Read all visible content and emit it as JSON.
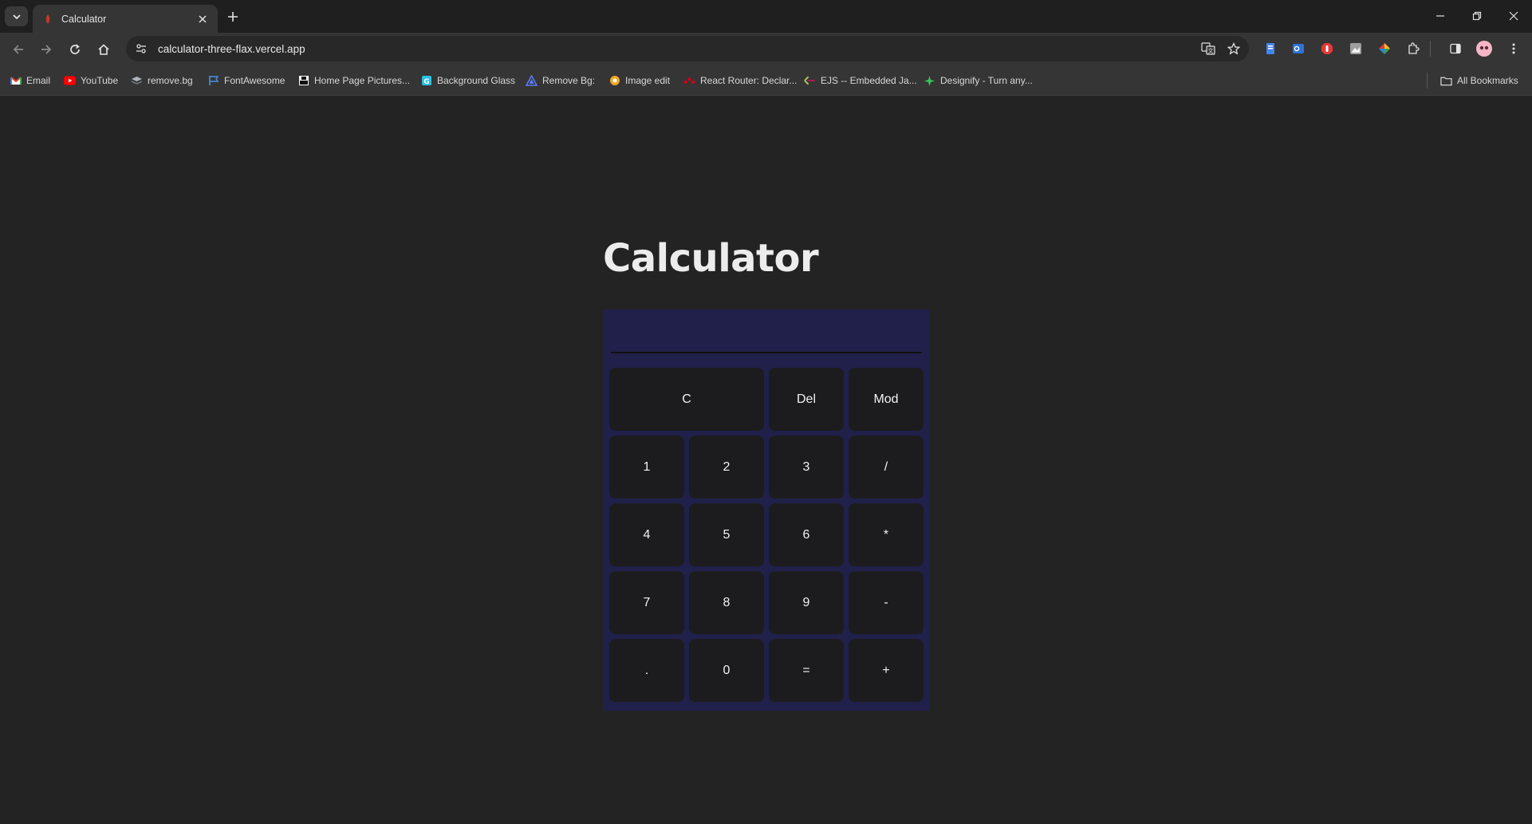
{
  "browser": {
    "tab_title": "Calculator",
    "url": "calculator-three-flax.vercel.app",
    "bookmarks": [
      {
        "label": "Email",
        "icon": "gmail-icon",
        "color": "#ea4335"
      },
      {
        "label": "YouTube",
        "icon": "youtube-icon",
        "color": "#ff0000"
      },
      {
        "label": "remove.bg",
        "icon": "removebg-icon",
        "color": "#9aa0a6"
      },
      {
        "label": "FontAwesome",
        "icon": "flag-icon",
        "color": "#4a90e2"
      },
      {
        "label": "Home Page Pictures...",
        "icon": "unsplash-icon",
        "color": "#ffffff"
      },
      {
        "label": "Background Glass",
        "icon": "glass-icon",
        "color": "#2bc0e4"
      },
      {
        "label": "Remove Bg:",
        "icon": "triangle-icon",
        "color": "#5b7cfa"
      },
      {
        "label": "Image edit",
        "icon": "image-edit-icon",
        "color": "#f5a623"
      },
      {
        "label": "React Router: Declar...",
        "icon": "react-router-icon",
        "color": "#d0021b"
      },
      {
        "label": "EJS -- Embedded Ja...",
        "icon": "ejs-icon",
        "color": "#b4ca65"
      },
      {
        "label": "Designify - Turn any...",
        "icon": "designify-icon",
        "color": "#34c759"
      }
    ],
    "all_bookmarks": "All Bookmarks"
  },
  "page": {
    "heading": "Calculator",
    "display_value": ""
  },
  "keys": {
    "clear": "C",
    "delete": "Del",
    "mod": "Mod",
    "one": "1",
    "two": "2",
    "three": "3",
    "divide": "/",
    "four": "4",
    "five": "5",
    "six": "6",
    "multiply": "*",
    "seven": "7",
    "eight": "8",
    "nine": "9",
    "minus": "-",
    "dot": ".",
    "zero": "0",
    "equals": "=",
    "plus": "+"
  },
  "colors": {
    "page_bg": "#232323",
    "calc_bg": "#20204a",
    "key_bg": "#1c1c1e",
    "text": "#f2f2f2"
  }
}
